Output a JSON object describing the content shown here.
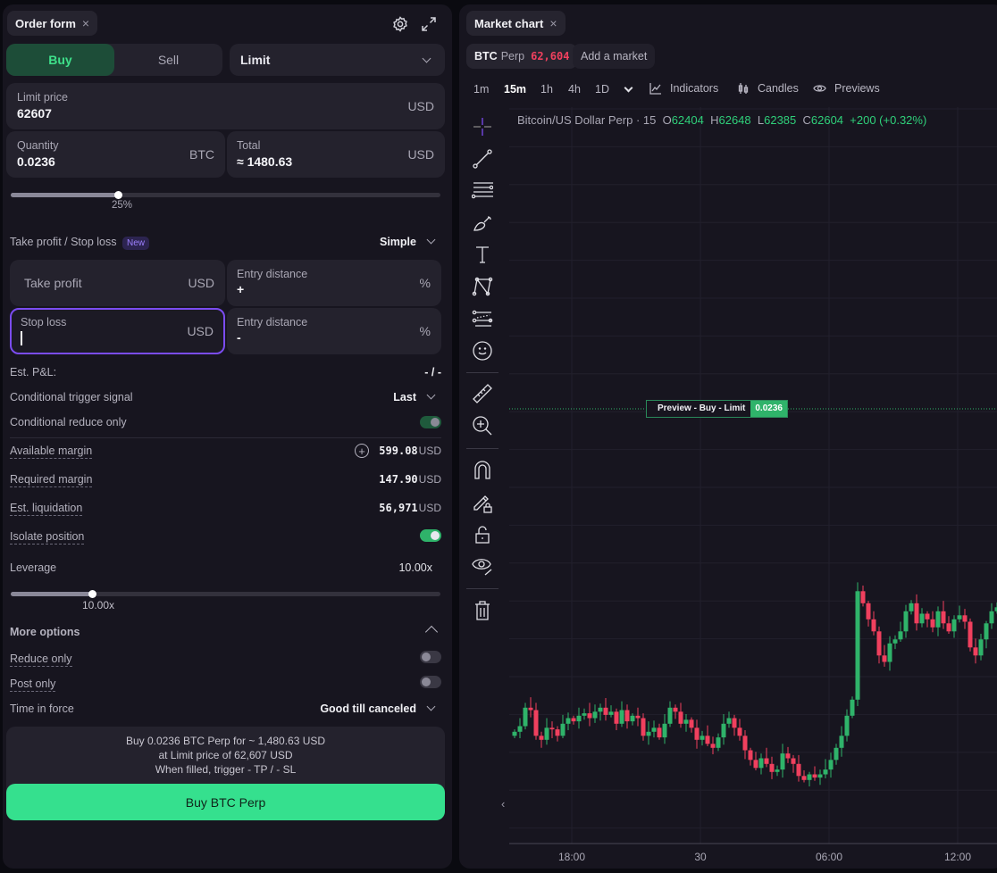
{
  "order_form": {
    "tab_label": "Order form",
    "close_icon": "×",
    "side": {
      "buy": "Buy",
      "sell": "Sell",
      "selected": "Buy"
    },
    "order_type": "Limit",
    "limit_price": {
      "label": "Limit price",
      "value": "62607",
      "unit": "USD"
    },
    "quantity": {
      "label": "Quantity",
      "value": "0.0236",
      "unit": "BTC"
    },
    "total": {
      "label": "Total",
      "value": "≈ 1480.63",
      "unit": "USD"
    },
    "size_slider": {
      "percent": 25,
      "label": "25%"
    },
    "tpsl": {
      "label": "Take profit / Stop loss",
      "badge": "New",
      "mode": "Simple",
      "take_profit": {
        "placeholder": "Take profit",
        "unit": "USD",
        "dist_label": "Entry distance",
        "dist_sign": "+",
        "dist_unit": "%"
      },
      "stop_loss": {
        "label": "Stop loss",
        "unit": "USD",
        "dist_label": "Entry distance",
        "dist_sign": "-",
        "dist_unit": "%"
      }
    },
    "est_pnl": {
      "label": "Est. P&L:",
      "value": "- / -"
    },
    "trigger_signal": {
      "label": "Conditional trigger signal",
      "value": "Last"
    },
    "cond_reduce_only": {
      "label": "Conditional reduce only",
      "on": true
    },
    "available_margin": {
      "label": "Available margin",
      "value": "599.08",
      "unit": "USD"
    },
    "required_margin": {
      "label": "Required margin",
      "value": "147.90",
      "unit": "USD"
    },
    "est_liquidation": {
      "label": "Est. liquidation",
      "value": "56,971",
      "unit": "USD"
    },
    "isolate_position": {
      "label": "Isolate position",
      "on": true
    },
    "leverage": {
      "label": "Leverage",
      "value": "10.00x",
      "slider_fraction": 0.19,
      "slider_label": "10.00x"
    },
    "more_options": {
      "label": "More options"
    },
    "reduce_only": {
      "label": "Reduce only",
      "on": false
    },
    "post_only": {
      "label": "Post only",
      "on": false
    },
    "time_in_force": {
      "label": "Time in force",
      "value": "Good till canceled"
    },
    "summary": {
      "line1": "Buy 0.0236 BTC Perp for ~ 1,480.63 USD",
      "line2": "at Limit price of 62,607 USD",
      "line3": "When filled, trigger - TP / - SL"
    },
    "submit": "Buy BTC Perp"
  },
  "market_chart": {
    "tab_label": "Market chart",
    "close_icon": "×",
    "market": {
      "symbol": "BTC",
      "type": "Perp",
      "price": "62,604"
    },
    "add_market": "Add a market",
    "timeframes": [
      "1m",
      "15m",
      "1h",
      "4h",
      "1D"
    ],
    "selected_timeframe": "15m",
    "indicators": "Indicators",
    "candles": "Candles",
    "previews": "Previews",
    "legend": {
      "title": "Bitcoin/US Dollar Perp · 15",
      "o_label": "O",
      "o": "62404",
      "h_label": "H",
      "h": "62648",
      "l_label": "L",
      "l": "62385",
      "c_label": "C",
      "c": "62604",
      "change": "+200 (+0.32%)"
    },
    "preview_line": {
      "label": "Preview - Buy - Limit",
      "qty": "0.0236",
      "price": 62607
    },
    "colors": {
      "up": "#2fb36a",
      "down": "#f0405e",
      "accent": "#7b4cf0"
    }
  },
  "chart_data": {
    "type": "candlestick",
    "x_tick_labels": [
      "18:00",
      "30",
      "06:00",
      "12:00"
    ],
    "closes": [
      62205,
      62212,
      62235,
      62232,
      62200,
      62195,
      62210,
      62208,
      62200,
      62215,
      62222,
      62218,
      62225,
      62228,
      62222,
      62230,
      62235,
      62226,
      62230,
      62215,
      62232,
      62218,
      62225,
      62222,
      62200,
      62205,
      62210,
      62198,
      62215,
      62235,
      62230,
      62215,
      62220,
      62210,
      62195,
      62200,
      62190,
      62185,
      62198,
      62215,
      62222,
      62210,
      62200,
      62182,
      62170,
      62160,
      62172,
      62165,
      62155,
      62158,
      62178,
      62172,
      62165,
      62150,
      62145,
      62152,
      62148,
      62152,
      62158,
      62170,
      62185,
      62200,
      62225,
      62245,
      62380,
      62365,
      62345,
      62330,
      62300,
      62292,
      62315,
      62320,
      62330,
      62355,
      62365,
      62340,
      62352,
      62345,
      62335,
      62355,
      62340,
      62330,
      62345,
      62350,
      62342,
      62310,
      62300,
      62320,
      62340,
      62355,
      62360
    ]
  }
}
